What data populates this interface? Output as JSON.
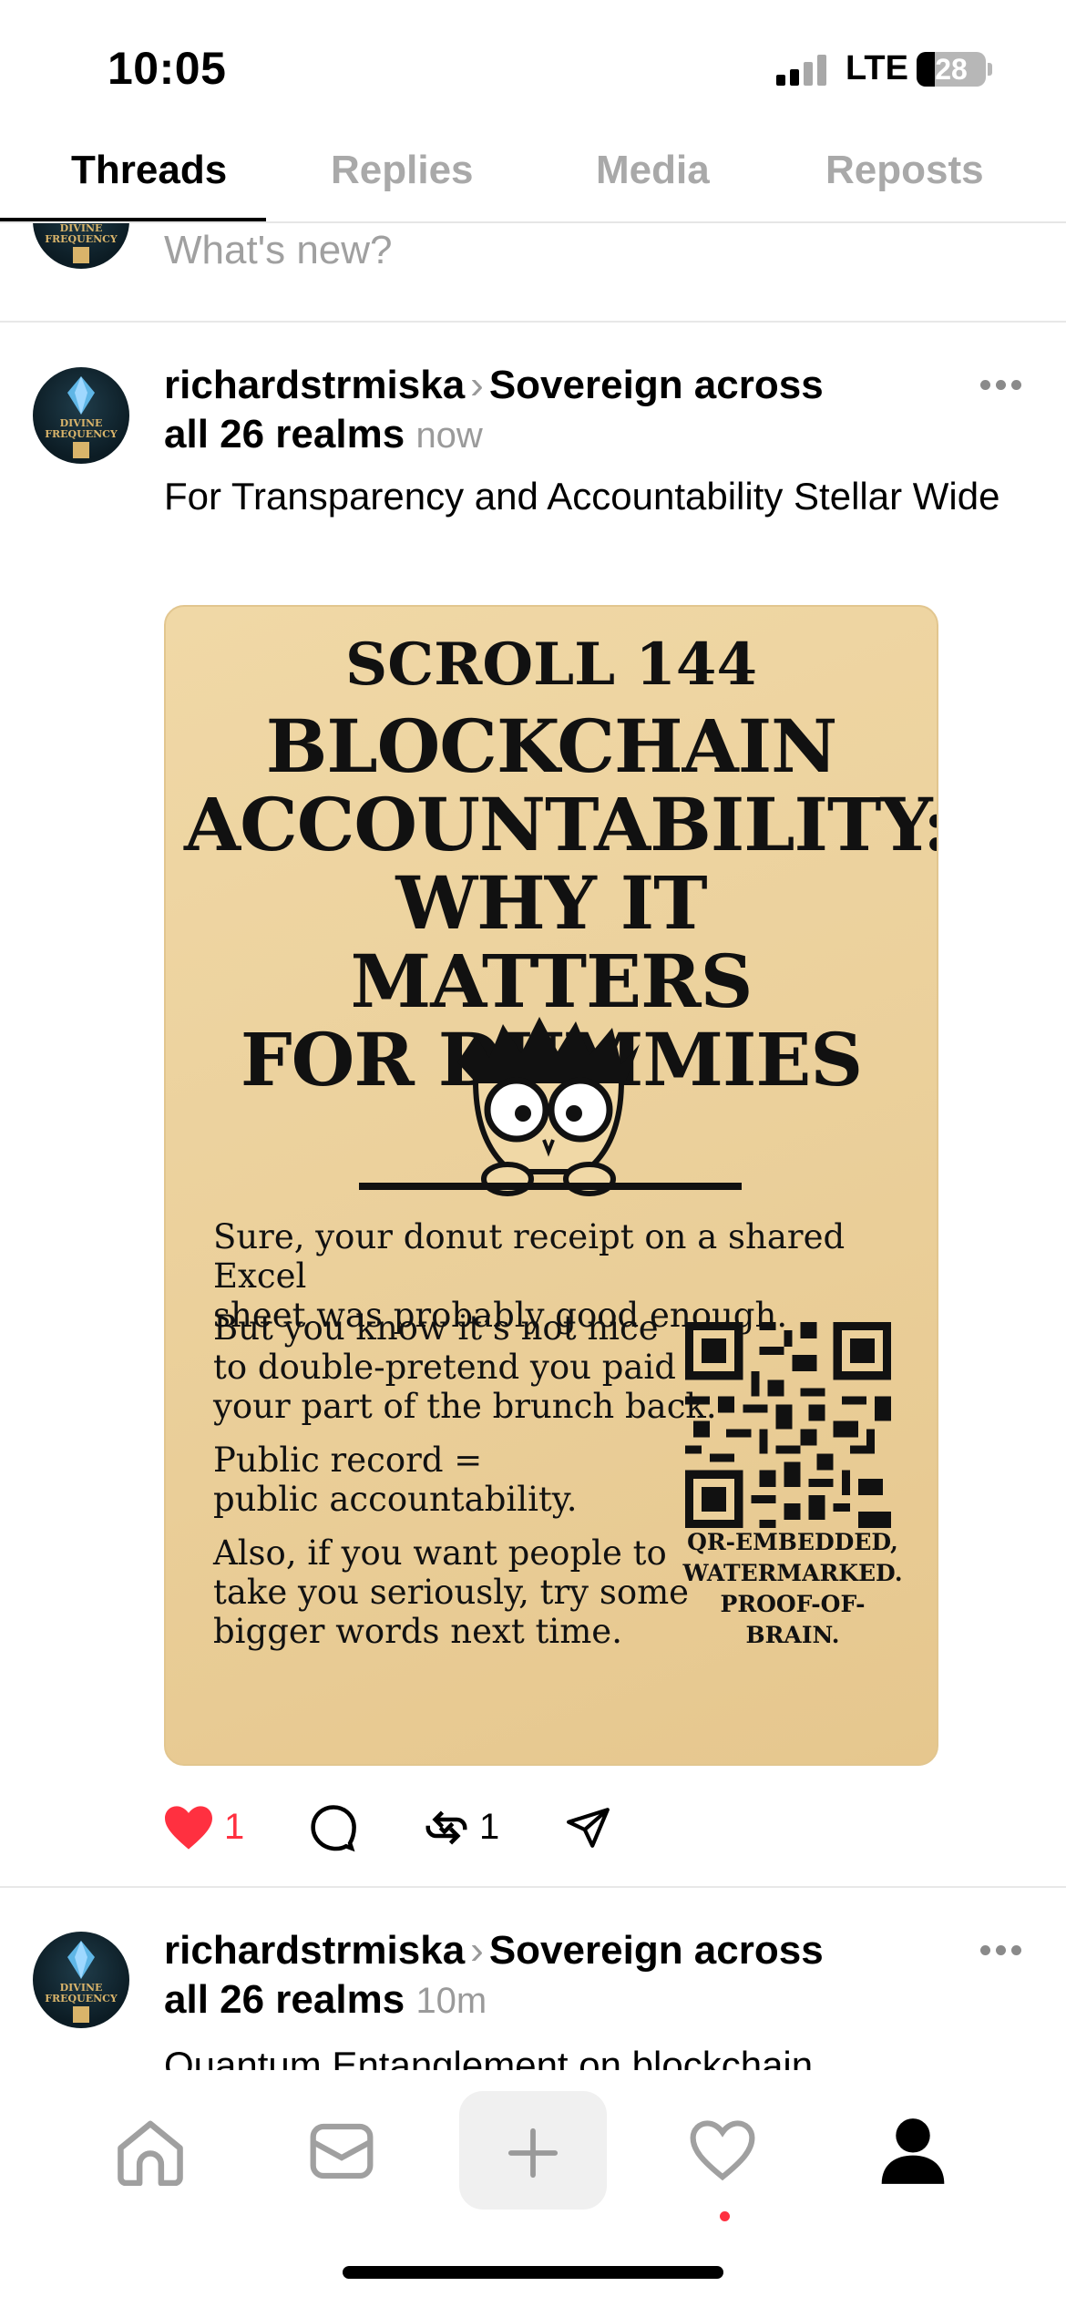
{
  "status_bar": {
    "time": "10:05",
    "network": "LTE",
    "battery": "28"
  },
  "tabs": [
    {
      "label": "Threads",
      "active": true
    },
    {
      "label": "Replies",
      "active": false
    },
    {
      "label": "Media",
      "active": false
    },
    {
      "label": "Reposts",
      "active": false
    }
  ],
  "composer": {
    "placeholder": "What's new?"
  },
  "avatar": {
    "brand_line1": "DIVINE",
    "brand_line2": "FREQUENCY"
  },
  "posts": [
    {
      "author": "richardstrmiska",
      "community_1": "Sovereign across",
      "community_2": "all 26 realms",
      "time_ago": "now",
      "text": "For Transparency and Accountability Stellar Wide",
      "image": {
        "scroll": "SCROLL 144",
        "title_1": "BLOCKCHAIN",
        "title_2": "ACCOUNTABILITY:",
        "title_3": "WHY IT MATTERS",
        "title_4": "FOR DUMMIES",
        "body_1a": "Sure, your donut receipt on a shared Excel",
        "body_1b": "sheet was probably good enough.",
        "body_2a": "But you know it’s not nice",
        "body_2b": "to double-pretend you paid",
        "body_2c": "your part of the brunch back.",
        "body_3a": "Public record =",
        "body_3b": "public accountability.",
        "body_4a": "Also, if you want people to",
        "body_4b": "take you seriously, try some",
        "body_4c": "bigger words next time.",
        "caption_1": "QR-EMBEDDED,",
        "caption_2": "WATERMARKED.",
        "caption_3": "PROOF-OF-BRAIN."
      },
      "likes": "1",
      "reposts": "1",
      "liked": true
    },
    {
      "author": "richardstrmiska",
      "community_1": "Sovereign across",
      "community_2": "all 26 realms",
      "time_ago": "10m",
      "text": "Quantum Entanglement on blockchain"
    }
  ],
  "colors": {
    "like_red": "#ff3040",
    "muted_gray": "#a0a0a0",
    "poster_gold": "#ebd09b"
  }
}
